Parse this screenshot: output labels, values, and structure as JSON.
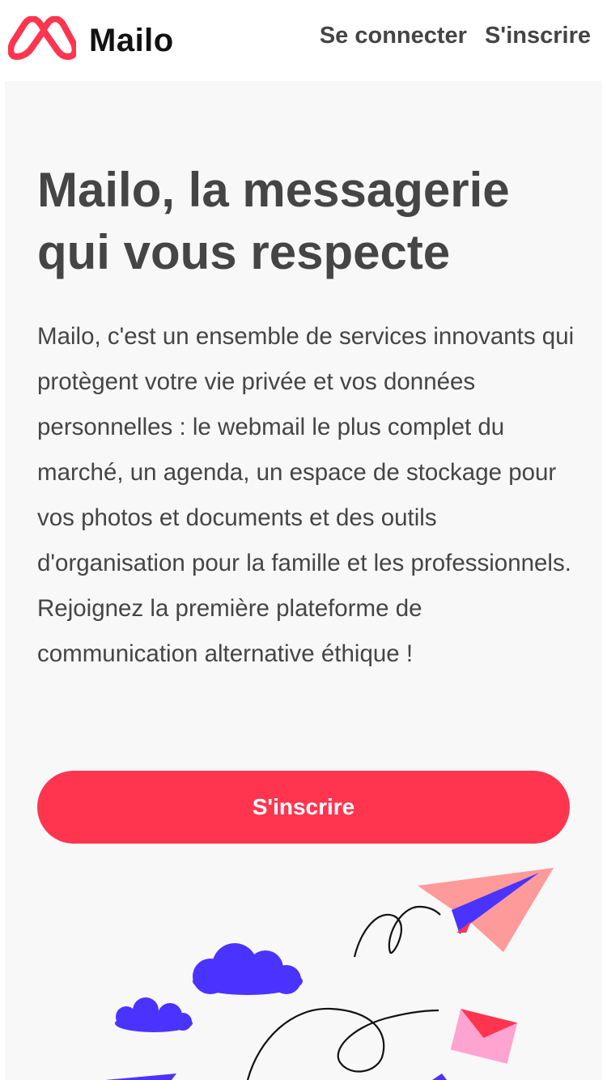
{
  "header": {
    "brand_name": "Mailo",
    "nav": {
      "login_label": "Se connecter",
      "signup_label": "S'inscrire"
    }
  },
  "hero": {
    "title": "Mailo, la messagerie qui vous respecte",
    "description": "Mailo, c'est un ensemble de services innovants qui protègent votre vie privée et vos données personnelles : le webmail le plus complet du marché, un agenda, un espace de stockage pour vos photos et documents et des outils d'organisation pour la famille et les professionnels. Rejoignez la première plateforme de communication alternative éthique !",
    "cta_label": "S'inscrire"
  },
  "colors": {
    "brand_red": "#ff3550",
    "text_gray": "#454545",
    "hero_background": "#f8f8f8",
    "cloud_purple": "#4b33ff",
    "plane_pink": "#ff9a9a",
    "envelope_pink": "#ffa3d0"
  },
  "icons": {
    "logo": "mailo-logo-icon",
    "illustration": [
      "paper-plane-icon",
      "cloud-icon",
      "envelope-icon"
    ]
  }
}
